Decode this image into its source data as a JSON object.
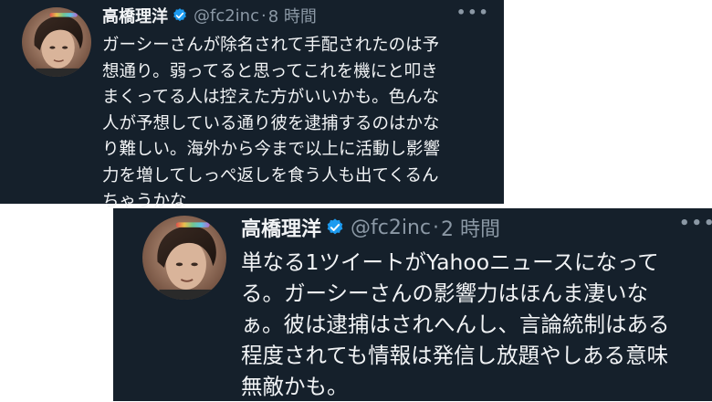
{
  "tweets": [
    {
      "author": {
        "name": "高橋理洋",
        "handle": "@fc2inc",
        "separator": "·",
        "time": "8 時間",
        "verified": true
      },
      "lines": [
        "ガーシーさんが除名されて手配されたのは予",
        "想通り。弱ってると思ってこれを機にと叩き",
        "まくってる人は控えた方がいいかも。色んな",
        "人が予想している通り彼を逮捕するのはかな",
        "り難しい。海外から今まで以上に活動し影響",
        "力を増してしっぺ返しを食う人も出てくるん",
        "ちゃうかな"
      ],
      "more_icon": "more-horizontal-icon"
    },
    {
      "author": {
        "name": "高橋理洋",
        "handle": "@fc2inc",
        "separator": "·",
        "time": "2 時間",
        "verified": true
      },
      "lines": [
        "単なる1ツイートがYahooニュースになって",
        "る。ガーシーさんの影響力はほんま凄いな",
        "ぁ。彼は逮捕はされへんし、言論統制はある",
        "程度されても情報は発信し放題やしある意味",
        "無敵かも。"
      ],
      "more_icon": "more-horizontal-icon"
    }
  ],
  "colors": {
    "background": "#15202b",
    "text": "#f1f3f5",
    "muted": "#8b98a5",
    "verified": "#1d9bf0"
  }
}
